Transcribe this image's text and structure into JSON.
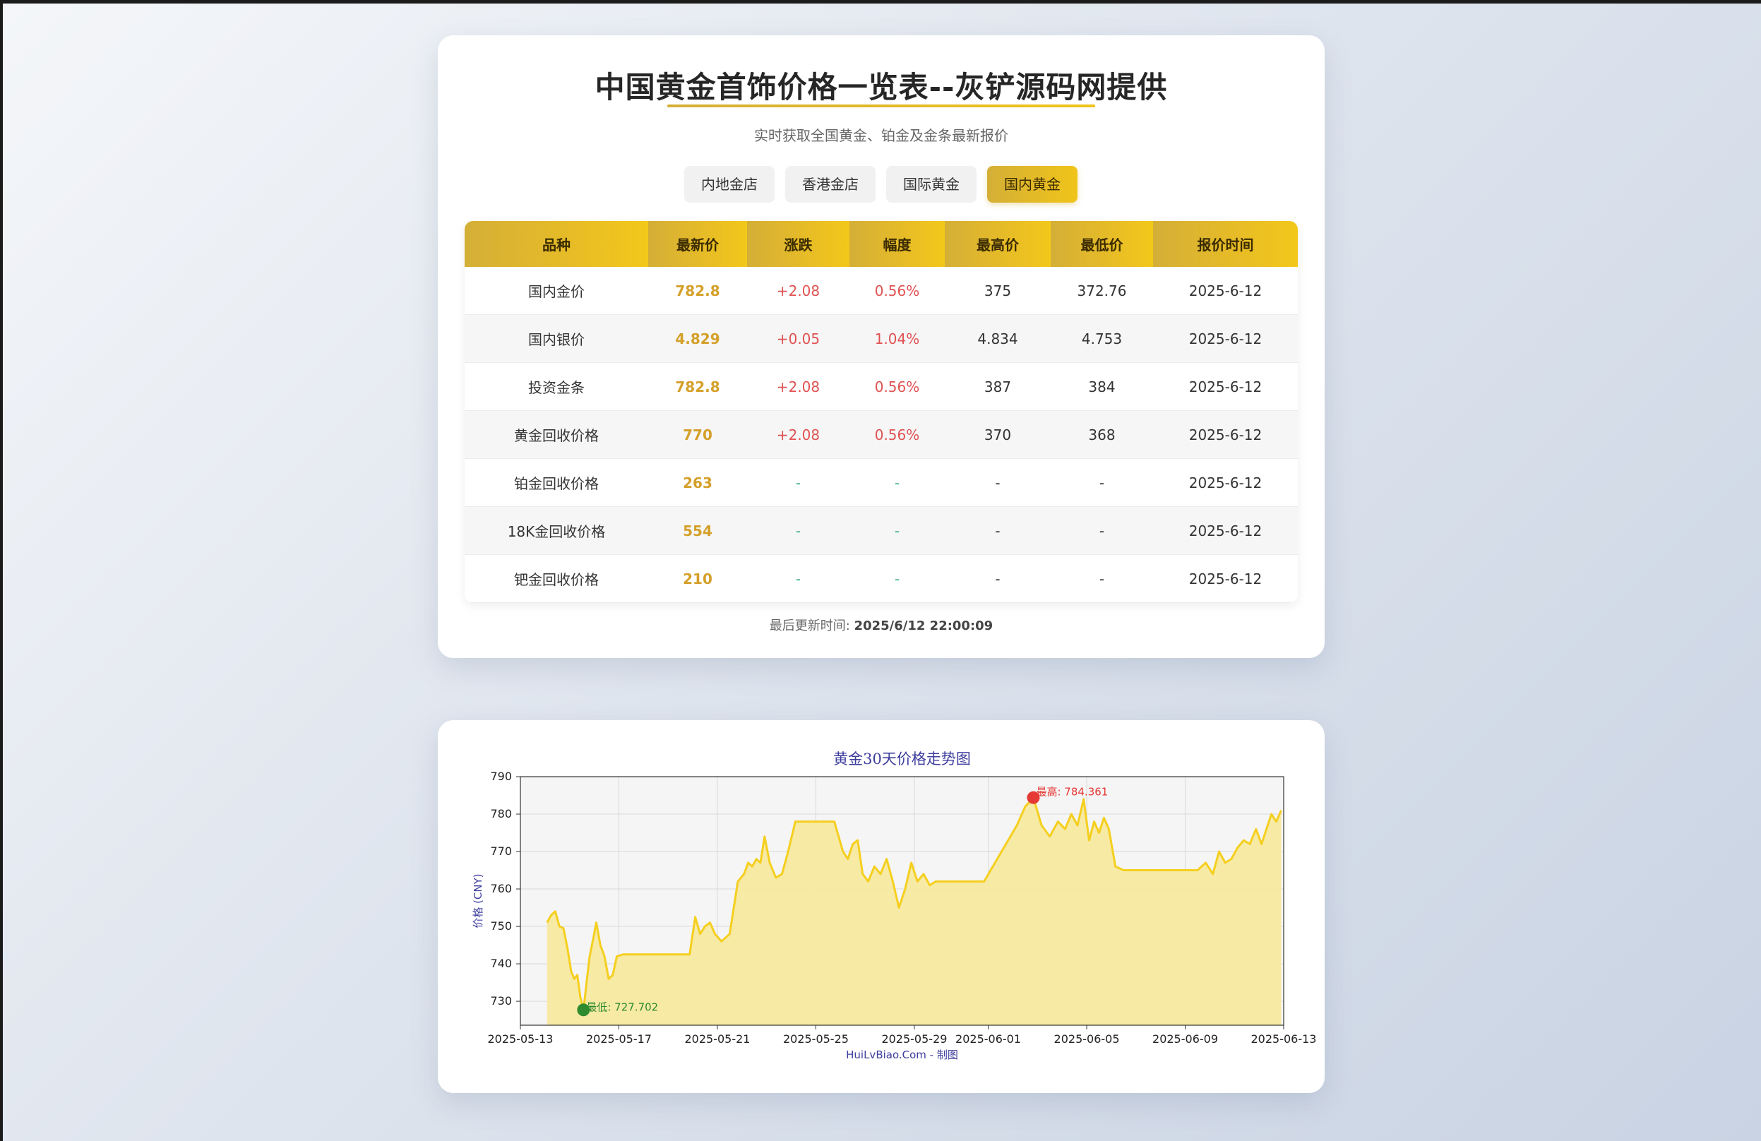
{
  "header": {
    "title": "中国黄金首饰价格一览表--灰铲源码网提供",
    "subtitle": "实时获取全国黄金、铂金及金条最新报价"
  },
  "tabs": [
    {
      "label": "内地金店",
      "active": false
    },
    {
      "label": "香港金店",
      "active": false
    },
    {
      "label": "国际黄金",
      "active": false
    },
    {
      "label": "国内黄金",
      "active": true
    }
  ],
  "table": {
    "columns": [
      "品种",
      "最新价",
      "涨跌",
      "幅度",
      "最高价",
      "最低价",
      "报价时间"
    ],
    "rows": [
      [
        "国内金价",
        "782.8",
        "+2.08",
        "0.56%",
        "375",
        "372.76",
        "2025-6-12"
      ],
      [
        "国内银价",
        "4.829",
        "+0.05",
        "1.04%",
        "4.834",
        "4.753",
        "2025-6-12"
      ],
      [
        "投资金条",
        "782.8",
        "+2.08",
        "0.56%",
        "387",
        "384",
        "2025-6-12"
      ],
      [
        "黄金回收价格",
        "770",
        "+2.08",
        "0.56%",
        "370",
        "368",
        "2025-6-12"
      ],
      [
        "铂金回收价格",
        "263",
        "-",
        "-",
        "-",
        "-",
        "2025-6-12"
      ],
      [
        "18K金回收价格",
        "554",
        "-",
        "-",
        "-",
        "-",
        "2025-6-12"
      ],
      [
        "钯金回收价格",
        "210",
        "-",
        "-",
        "-",
        "-",
        "2025-6-12"
      ]
    ]
  },
  "footer": {
    "updated_label": "最后更新时间:",
    "updated_value": "2025/6/12 22:00:09"
  },
  "colors": {
    "gold_start": "#d4af37",
    "gold_end": "#f0c419",
    "price": "#d4a02a",
    "up": "#e05252",
    "line": "#f5cf1f",
    "fill": "#f7e9a0",
    "max_marker": "#e53935",
    "min_marker": "#2e8b2e"
  },
  "chart_data": {
    "type": "area",
    "title": "黄金30天价格走势图",
    "xlabel": "HuiLvBiao.Com - 制图",
    "ylabel": "价格 (CNY)",
    "ylim": [
      723.6,
      790
    ],
    "xlim": [
      "2025-05-13",
      "2025-06-13"
    ],
    "x_ticks": [
      "2025-05-13",
      "2025-05-17",
      "2025-05-21",
      "2025-05-25",
      "2025-05-29",
      "2025-06-01",
      "2025-06-05",
      "2025-06-09",
      "2025-06-13"
    ],
    "y_ticks": [
      730,
      740,
      750,
      760,
      770,
      780,
      790
    ],
    "grid": true,
    "annotations": [
      {
        "label": "最高: 784.361",
        "x": "2025-06-03",
        "y": 784.361
      },
      {
        "label": "最低: 727.702",
        "x": "2025-05-15",
        "y": 727.702
      }
    ],
    "series": [
      {
        "x": [
          "2025-05-14",
          "2025-05-14",
          "2025-05-14",
          "2025-05-14",
          "2025-05-14",
          "2025-05-14",
          "2025-05-15",
          "2025-05-15",
          "2025-05-15",
          "2025-05-15",
          "2025-05-15",
          "2025-05-15",
          "2025-05-15",
          "2025-05-15",
          "2025-05-16",
          "2025-05-16",
          "2025-05-16",
          "2025-05-16",
          "2025-05-16",
          "2025-05-16",
          "2025-05-17",
          "2025-05-17",
          "2025-05-17",
          "2025-05-19",
          "2025-05-19",
          "2025-05-19",
          "2025-05-19",
          "2025-05-20",
          "2025-05-20",
          "2025-05-20",
          "2025-05-20",
          "2025-05-20",
          "2025-05-21",
          "2025-05-21",
          "2025-05-21",
          "2025-05-22",
          "2025-05-22",
          "2025-05-22",
          "2025-05-22",
          "2025-05-22",
          "2025-05-22",
          "2025-05-23",
          "2025-05-23",
          "2025-05-23",
          "2025-05-23",
          "2025-05-24",
          "2025-05-24",
          "2025-05-24",
          "2025-05-25",
          "2025-05-25",
          "2025-05-26",
          "2025-05-26",
          "2025-05-26",
          "2025-05-26",
          "2025-05-26",
          "2025-05-27",
          "2025-05-27",
          "2025-05-27",
          "2025-05-27",
          "2025-05-28",
          "2025-05-28",
          "2025-05-28",
          "2025-05-28",
          "2025-05-29",
          "2025-05-29",
          "2025-05-29",
          "2025-05-29",
          "2025-05-30",
          "2025-05-30",
          "2025-05-30",
          "2025-05-30",
          "2025-05-31",
          "2025-05-31",
          "2025-05-31",
          "2025-06-02",
          "2025-06-02",
          "2025-06-02",
          "2025-06-03",
          "2025-06-03",
          "2025-06-03",
          "2025-06-04",
          "2025-06-04",
          "2025-06-04",
          "2025-06-04",
          "2025-06-05",
          "2025-06-05",
          "2025-06-05",
          "2025-06-05",
          "2025-06-05",
          "2025-06-06",
          "2025-06-06",
          "2025-06-06",
          "2025-06-07",
          "2025-06-09",
          "2025-06-09",
          "2025-06-09",
          "2025-06-10",
          "2025-06-10",
          "2025-06-10",
          "2025-06-10",
          "2025-06-11",
          "2025-06-11",
          "2025-06-11",
          "2025-06-11",
          "2025-06-12",
          "2025-06-12",
          "2025-06-12",
          "2025-06-12",
          "2025-06-12"
        ],
        "values": [
          751,
          753,
          754,
          750,
          749.5,
          744,
          738,
          736,
          737,
          731,
          727.7,
          735,
          742,
          746,
          751,
          745,
          742,
          736,
          737,
          742,
          742.5,
          742.5,
          742.5,
          742.5,
          742.5,
          742.5,
          742.5,
          752.5,
          748,
          750,
          751,
          748,
          746,
          748,
          762,
          764,
          767,
          766,
          768,
          767,
          774,
          767,
          763,
          764,
          770,
          778,
          778,
          778,
          778,
          778,
          770,
          768,
          772,
          773,
          764,
          762,
          766,
          764,
          768,
          762,
          755,
          760,
          767,
          762,
          764,
          761,
          762,
          762,
          762,
          762,
          762,
          762,
          762,
          762,
          777,
          782,
          784.4,
          777,
          774,
          778,
          776,
          780,
          777,
          784,
          773,
          778,
          775,
          779,
          776,
          766,
          765,
          765,
          765,
          765,
          765,
          767,
          764,
          770,
          767,
          768,
          771,
          773,
          772,
          776,
          772,
          776,
          780,
          778,
          781
        ]
      }
    ]
  }
}
